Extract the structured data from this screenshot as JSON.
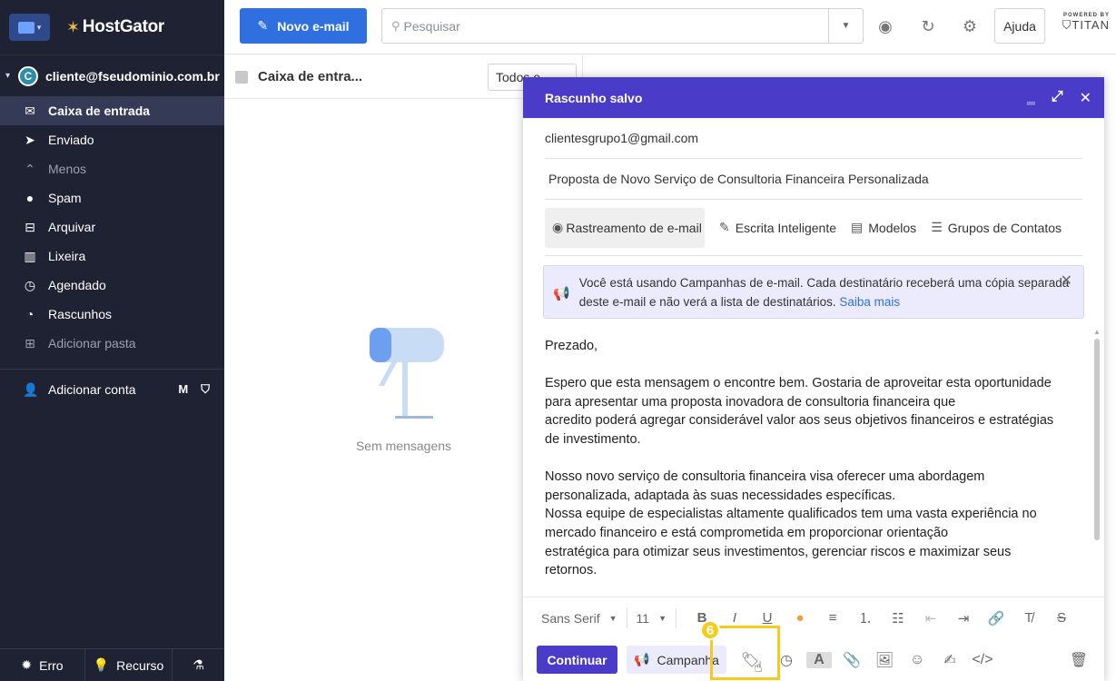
{
  "sidebar": {
    "brand": "HostGator",
    "account_initial": "C",
    "account_email": "cliente@fseudominio.com.br",
    "items": [
      {
        "label": "Caixa de entrada",
        "icon": "inbox-icon"
      },
      {
        "label": "Enviado",
        "icon": "send-icon"
      },
      {
        "label": "Menos",
        "icon": "chevron-up-icon"
      },
      {
        "label": "Spam",
        "icon": "spam-icon"
      },
      {
        "label": "Arquivar",
        "icon": "archive-icon"
      },
      {
        "label": "Lixeira",
        "icon": "trash-icon"
      },
      {
        "label": "Agendado",
        "icon": "scheduled-icon"
      },
      {
        "label": "Rascunhos",
        "icon": "drafts-icon"
      },
      {
        "label": "Adicionar pasta",
        "icon": "add-folder-icon"
      }
    ],
    "add_account": "Adicionar conta",
    "bottom": {
      "error": "Erro",
      "feature": "Recurso"
    }
  },
  "topbar": {
    "new_email": "Novo e-mail",
    "search_placeholder": "Pesquisar",
    "help": "Ajuda",
    "powered_by": "POWERED BY",
    "titan": "TITAN"
  },
  "list": {
    "folder_title": "Caixa de entra...",
    "filter": "Todos e...",
    "empty": "Sem mensagens"
  },
  "compose": {
    "title": "Rascunho salvo",
    "to": "clientesgrupo1@gmail.com",
    "subject": "Proposta de Novo Serviço de Consultoria Financeira Personalizada",
    "tools": {
      "tracking": "Rastreamento de e-mail",
      "smart_write": "Escrita Inteligente",
      "templates": "Modelos",
      "contact_groups": "Grupos de Contatos"
    },
    "notice": {
      "text": "Você está usando Campanhas de e-mail. Cada destinatário receberá uma cópia separada deste e-mail e não verá a lista de destinatários.",
      "link": "Saiba mais"
    },
    "body": {
      "greeting": "Prezado,",
      "p1_l1": "Espero que esta mensagem o encontre bem. Gostaria de aproveitar esta oportunidade",
      "p1_l2": "para apresentar uma proposta inovadora de consultoria financeira que",
      "p1_l3": "acredito poderá agregar considerável valor aos seus objetivos financeiros e estratégias",
      "p1_l4": "de investimento.",
      "p2_l1": "Nosso novo serviço de consultoria financeira visa oferecer uma abordagem",
      "p2_l2": "personalizada, adaptada às suas necessidades específicas.",
      "p2_l3": "Nossa equipe de especialistas altamente qualificados tem uma vasta experiência no",
      "p2_l4": "mercado financeiro e está comprometida em proporcionar orientação",
      "p2_l5": "estratégica para otimizar seus investimentos, gerenciar riscos e maximizar seus",
      "p2_l6": "retornos."
    },
    "format": {
      "font": "Sans Serif",
      "size": "11"
    },
    "continue": "Continuar",
    "campaign": "Campanha",
    "step_badge": "6"
  }
}
